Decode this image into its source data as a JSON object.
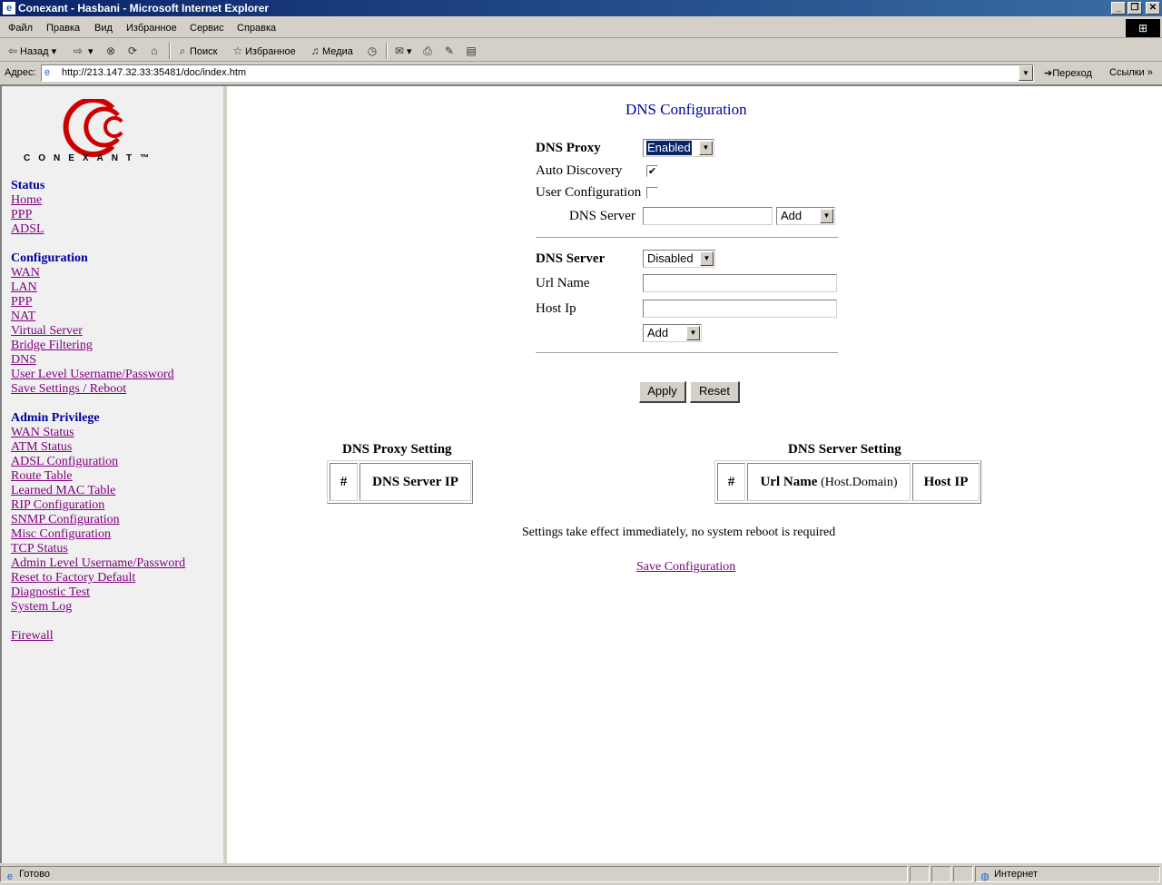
{
  "window": {
    "title": "Conexant - Hasbani - Microsoft Internet Explorer",
    "minimize": "_",
    "restore": "❐",
    "close": "✕"
  },
  "menu": [
    "Файл",
    "Правка",
    "Вид",
    "Избранное",
    "Сервис",
    "Справка"
  ],
  "toolbar": {
    "back": "Назад",
    "search": "Поиск",
    "favorites": "Избранное",
    "media": "Медиа"
  },
  "address": {
    "label": "Адрес:",
    "url": "http://213.147.32.33:35481/doc/index.htm",
    "go": "Переход",
    "links": "Ссылки"
  },
  "sidebar": {
    "logo_text": "CONEXANT™",
    "status": {
      "heading": "Status",
      "links": [
        "Home",
        "PPP",
        "ADSL"
      ]
    },
    "configuration": {
      "heading": "Configuration",
      "links": [
        "WAN",
        "LAN",
        "PPP",
        "NAT",
        "Virtual Server",
        "Bridge Filtering",
        "DNS",
        "User Level Username/Password",
        "Save Settings / Reboot"
      ]
    },
    "admin": {
      "heading": "Admin Privilege",
      "links": [
        "WAN Status",
        "ATM Status",
        "ADSL Configuration",
        "Route Table",
        "Learned MAC Table",
        "RIP Configuration",
        "SNMP Configuration",
        "Misc Configuration",
        "TCP Status",
        "Admin Level Username/Password",
        "Reset to Factory Default",
        "Diagnostic Test",
        "System Log"
      ]
    },
    "firewall": "Firewall"
  },
  "main": {
    "title": "DNS Configuration",
    "dns_proxy": {
      "label": "DNS Proxy",
      "value": "Enabled",
      "auto_discovery_label": "Auto Discovery",
      "auto_discovery_checked": "✔",
      "user_config_label": "User Configuration",
      "dns_server_label": "DNS Server",
      "dns_server_value": "",
      "action_value": "Add"
    },
    "dns_server": {
      "label": "DNS Server",
      "value": "Disabled",
      "url_label": "Url Name",
      "url_value": "",
      "host_label": "Host Ip",
      "host_value": "",
      "action_value": "Add"
    },
    "apply": "Apply",
    "reset": "Reset",
    "proxy_table": {
      "title": "DNS Proxy Setting",
      "col_num": "#",
      "col_ip": "DNS Server IP"
    },
    "server_table": {
      "title": "DNS Server Setting",
      "col_num": "#",
      "col_url": "Url Name",
      "col_url_suffix": "(Host.Domain)",
      "col_host": "Host IP"
    },
    "message": "Settings take effect immediately, no system reboot is required",
    "save_link": "Save Configuration"
  },
  "statusbar": {
    "text": "Готово",
    "zone": "Интернет"
  }
}
